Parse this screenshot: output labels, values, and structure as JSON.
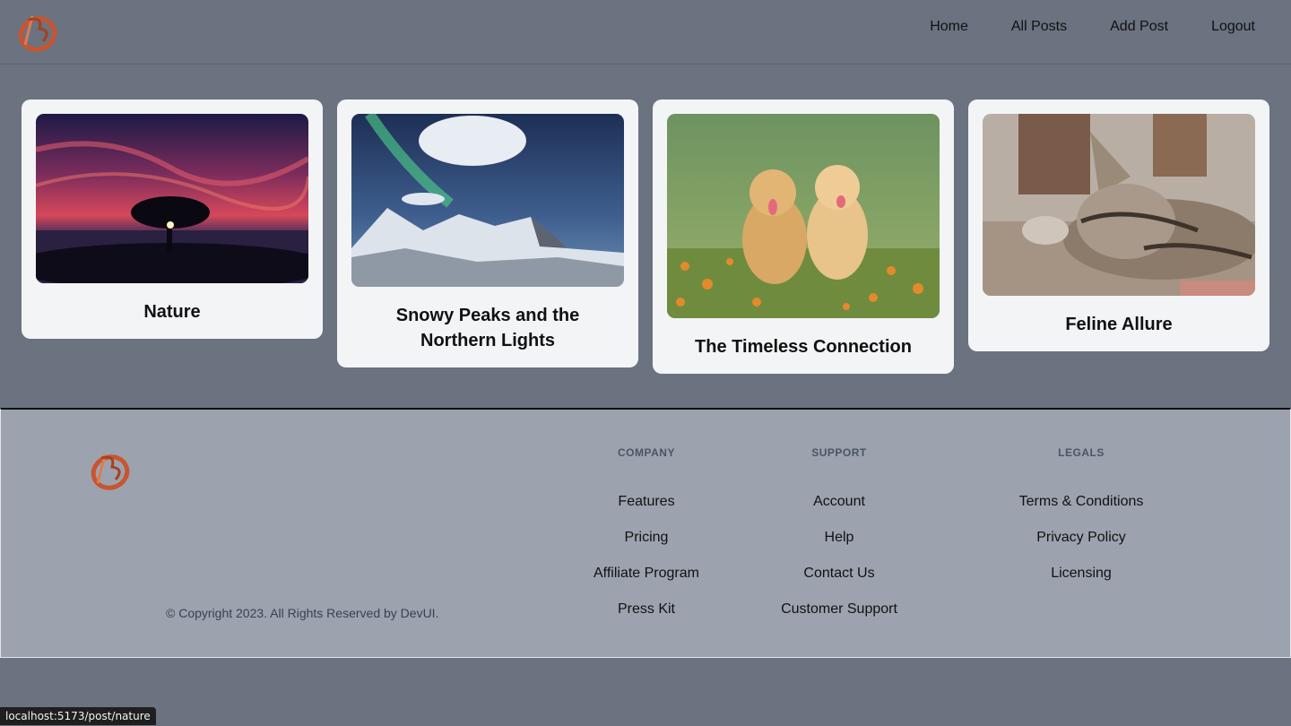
{
  "header": {
    "nav": [
      "Home",
      "All Posts",
      "Add Post",
      "Logout"
    ]
  },
  "posts": [
    {
      "title": "Nature",
      "image": "sunset-tree-image"
    },
    {
      "title": "Snowy Peaks and the Northern Lights",
      "image": "aurora-mountains-image"
    },
    {
      "title": "The Timeless Connection",
      "image": "puppies-image"
    },
    {
      "title": "Feline Allure",
      "image": "sleeping-kitten-image"
    }
  ],
  "footer": {
    "copyright": "© Copyright 2023. All Rights Reserved by DevUI.",
    "columns": [
      {
        "heading": "COMPANY",
        "links": [
          "Features",
          "Pricing",
          "Affiliate Program",
          "Press Kit"
        ]
      },
      {
        "heading": "SUPPORT",
        "links": [
          "Account",
          "Help",
          "Contact Us",
          "Customer Support"
        ]
      },
      {
        "heading": "LEGALS",
        "links": [
          "Terms & Conditions",
          "Privacy Policy",
          "Licensing"
        ]
      }
    ]
  },
  "status_url": "localhost:5173/post/nature",
  "colors": {
    "page_bg": "#6b7280",
    "card_bg": "#f3f4f6",
    "footer_bg": "#9ca3af",
    "logo": "#d8613c"
  }
}
